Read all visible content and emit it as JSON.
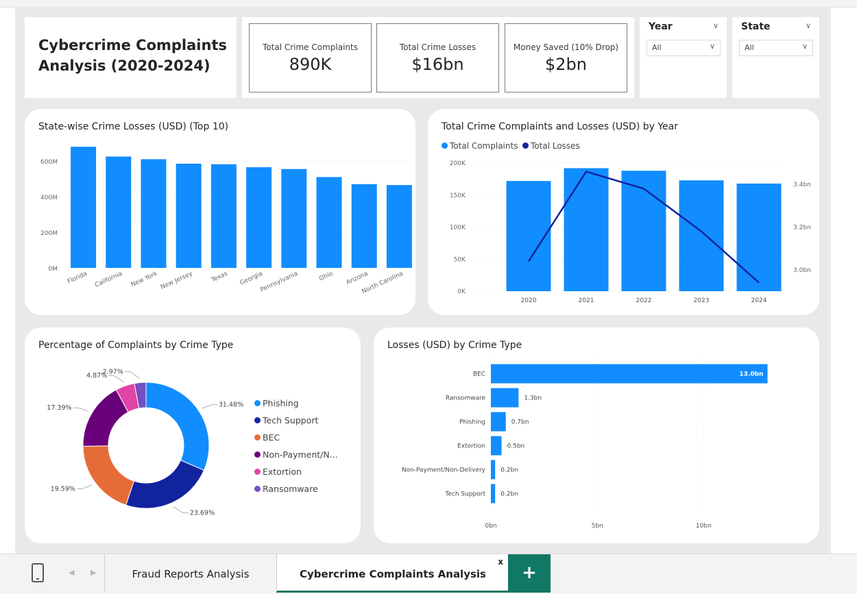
{
  "dashboard": {
    "title_line1": "Cybercrime Complaints",
    "title_line2": "Analysis (2020-2024)"
  },
  "kpis": [
    {
      "label": "Total Crime Complaints",
      "value": "890K"
    },
    {
      "label": "Total Crime Losses",
      "value": "$16bn"
    },
    {
      "label": "Money Saved (10% Drop)",
      "value": "$2bn"
    }
  ],
  "slicers": [
    {
      "title": "Year",
      "selected": "All"
    },
    {
      "title": "State",
      "selected": "All"
    }
  ],
  "colors": {
    "blue": "#118dff",
    "navy": "#12239e",
    "orange": "#e66c37",
    "purple": "#6b007b",
    "pink": "#e044a7",
    "violet": "#744ec2",
    "green": "#117865"
  },
  "state_chart": {
    "title": "State-wise Crime Losses (USD) (Top 10)",
    "chart_data": {
      "type": "bar",
      "categories": [
        "Florida",
        "California",
        "New York",
        "New Jersey",
        "Texas",
        "Georgia",
        "Pennsylvania",
        "Ohio",
        "Arizona",
        "North Carolina"
      ],
      "values": [
        680,
        625,
        610,
        585,
        582,
        565,
        555,
        510,
        470,
        465
      ],
      "unit": "M",
      "y_ticks": [
        "0M",
        "200M",
        "400M",
        "600M"
      ],
      "ylim": [
        0,
        700
      ]
    }
  },
  "year_chart": {
    "title": "Total Crime Complaints and Losses (USD) by Year",
    "legend": [
      "Total Complaints",
      "Total Losses"
    ],
    "chart_data": {
      "type": "bar",
      "categories": [
        "2020",
        "2021",
        "2022",
        "2023",
        "2024"
      ],
      "series": [
        {
          "name": "Total Complaints",
          "type": "bar",
          "values": [
            172000,
            192000,
            188000,
            173000,
            168000
          ]
        },
        {
          "name": "Total Losses",
          "type": "line",
          "values": [
            3.04,
            3.46,
            3.38,
            3.18,
            2.94
          ]
        }
      ],
      "y_ticks": [
        "0K",
        "50K",
        "100K",
        "150K",
        "200K"
      ],
      "ylim": [
        0,
        200000
      ],
      "y2_ticks": [
        "3.0bn",
        "3.2bn",
        "3.4bn"
      ],
      "y2lim": [
        2.9,
        3.5
      ]
    }
  },
  "pie_chart": {
    "title": "Percentage of Complaints by Crime Type",
    "legend": [
      "Phishing",
      "Tech Support",
      "BEC",
      "Non-Payment/N...",
      "Extortion",
      "Ransomware"
    ],
    "chart_data": {
      "type": "pie",
      "categories": [
        "Phishing",
        "Tech Support",
        "BEC",
        "Non-Payment/Non-Delivery",
        "Extortion",
        "Ransomware"
      ],
      "values": [
        31.48,
        23.69,
        19.59,
        17.39,
        4.87,
        2.97
      ],
      "labels": [
        "31.48%",
        "23.69%",
        "19.59%",
        "17.39%",
        "4.87%",
        "2.97%"
      ]
    }
  },
  "loss_chart": {
    "title": "Losses (USD) by Crime Type",
    "chart_data": {
      "type": "bar",
      "orientation": "horizontal",
      "categories": [
        "BEC",
        "Ransomware",
        "Phishing",
        "Extortion",
        "Non-Payment/Non-Delivery",
        "Tech Support"
      ],
      "values": [
        13.0,
        1.3,
        0.7,
        0.5,
        0.2,
        0.2
      ],
      "labels": [
        "13.0bn",
        "1.3bn",
        "0.7bn",
        "0.5bn",
        "0.2bn",
        "0.2bn"
      ],
      "x_ticks": [
        "0bn",
        "5bn",
        "10bn"
      ],
      "xlim": [
        0,
        13.5
      ]
    }
  },
  "tabs": {
    "items": [
      "Fraud Reports Analysis",
      "Cybercrime Complaints Analysis"
    ],
    "close": "x",
    "add": "+"
  }
}
